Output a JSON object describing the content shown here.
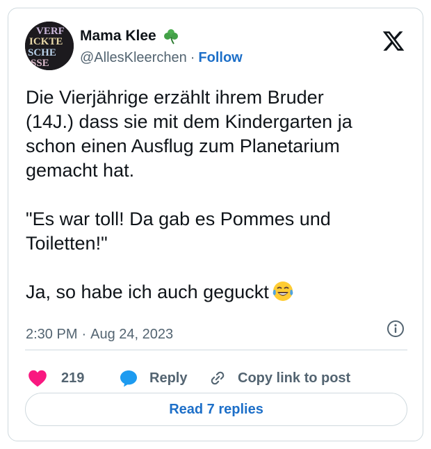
{
  "user": {
    "display_name": "Mama Klee",
    "handle": "@AllesKleerchen",
    "separator": "·",
    "follow_label": "Follow",
    "avatar_text": [
      "VERF",
      "ICKTE",
      "SCHE",
      "SSE"
    ]
  },
  "tweet": {
    "paragraphs": [
      [
        "Die Vierjährige erzählt ihrem Bruder",
        "(14J.) dass sie mit dem Kindergarten ja",
        "schon einen Ausflug zum Planetarium",
        "gemacht hat."
      ],
      [
        "\"Es war toll! Da gab es Pommes und",
        "Toiletten!\""
      ],
      [
        "Ja, so habe ich auch geguckt"
      ]
    ],
    "time": "2:30 PM",
    "dot": "·",
    "date": "Aug 24, 2023"
  },
  "actions": {
    "likes": "219",
    "reply_label": "Reply",
    "copy_label": "Copy link to post"
  },
  "read_replies_label": "Read 7 replies",
  "icons": {
    "clover": "shamrock-icon",
    "emoji": "tears-of-joy-emoji",
    "logo": "x-logo-icon",
    "info": "info-icon",
    "like": "heart-icon",
    "reply": "speech-bubble-icon",
    "copy": "link-icon"
  },
  "colors": {
    "accent": "#1d6fc8",
    "like": "#f91880",
    "text": "#0f1419",
    "muted": "#536471",
    "border": "#cfd9de"
  }
}
